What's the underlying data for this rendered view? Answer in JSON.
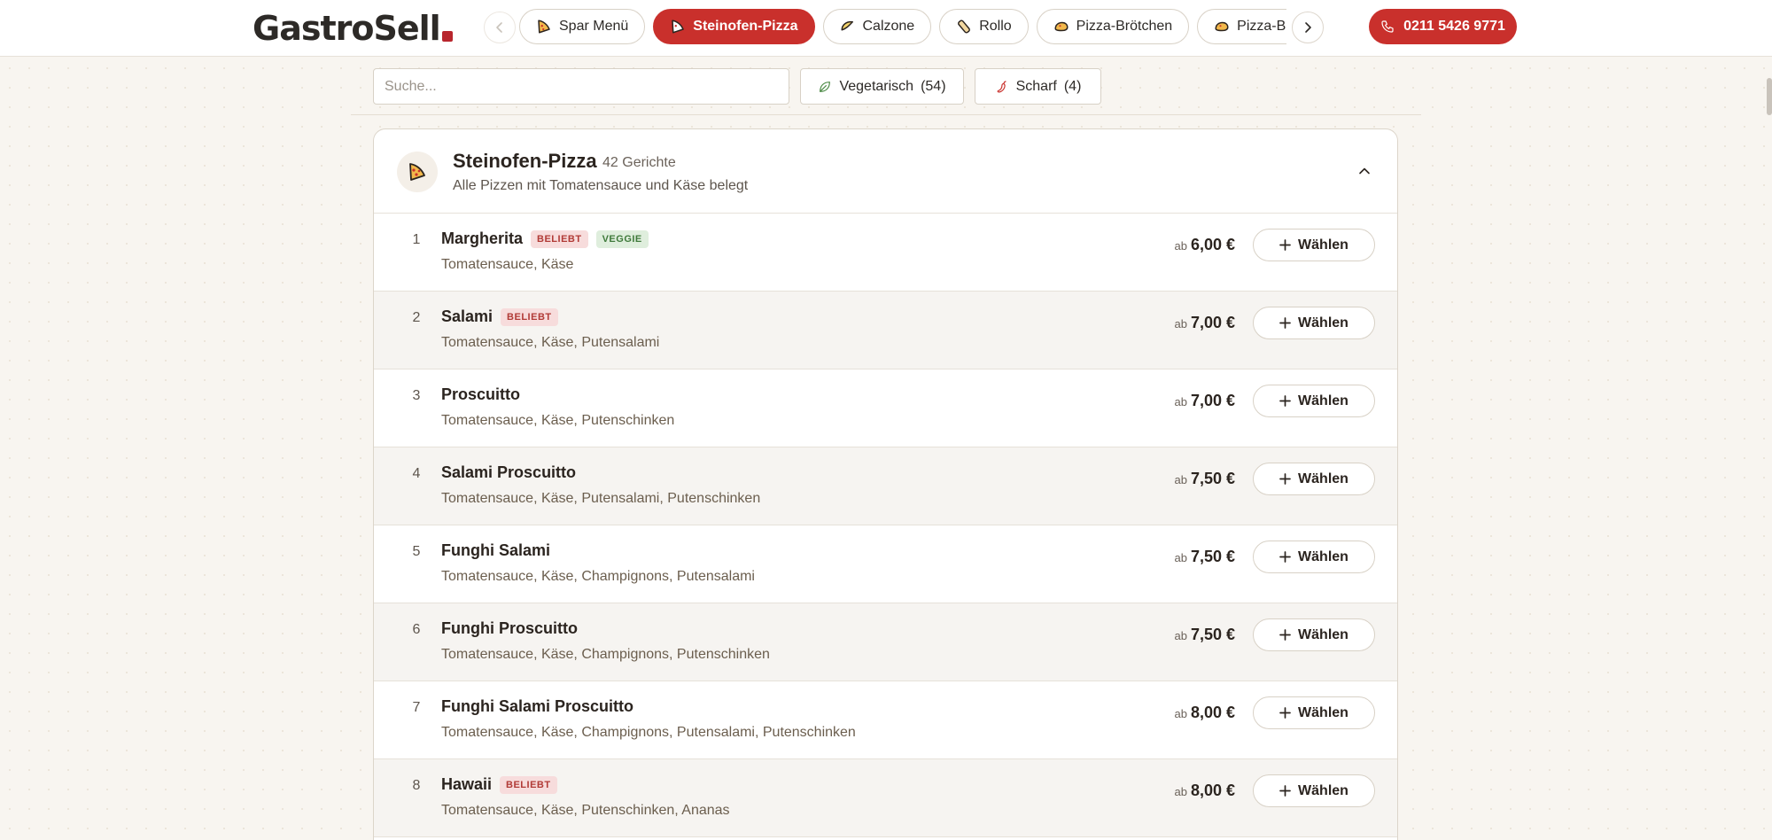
{
  "header": {
    "logo": "GastroSell",
    "tabs": [
      {
        "label": "Spar Menü",
        "icon": "pizza-slice-icon",
        "active": false
      },
      {
        "label": "Steinofen-Pizza",
        "icon": "pizza-slice-icon",
        "active": true
      },
      {
        "label": "Calzone",
        "icon": "calzone-icon",
        "active": false
      },
      {
        "label": "Rollo",
        "icon": "wrap-icon",
        "active": false
      },
      {
        "label": "Pizza-Brötchen",
        "icon": "bread-roll-icon",
        "active": false
      },
      {
        "label": "Pizza-Brot",
        "icon": "bread-roll-icon",
        "active": false
      }
    ],
    "phone": "0211 5426 9771"
  },
  "filters": {
    "search_placeholder": "Suche...",
    "vegetarian": "Vegetarisch",
    "vegetarian_count": "(54)",
    "spicy": "Scharf",
    "spicy_count": "(4)"
  },
  "category": {
    "title": "Steinofen-Pizza",
    "count": "42 Gerichte",
    "description": "Alle Pizzen mit Tomatensauce und Käse belegt"
  },
  "labels": {
    "price_prefix": "ab",
    "choose": "Wählen",
    "popular": "BELIEBT",
    "veggie": "VEGGIE"
  },
  "items": [
    {
      "num": "1",
      "name": "Margherita",
      "popular": true,
      "veggie": true,
      "desc": "Tomatensauce, Käse",
      "price": "6,00 €"
    },
    {
      "num": "2",
      "name": "Salami",
      "popular": true,
      "veggie": false,
      "desc": "Tomatensauce, Käse, Putensalami",
      "price": "7,00 €"
    },
    {
      "num": "3",
      "name": "Proscuitto",
      "popular": false,
      "veggie": false,
      "desc": "Tomatensauce, Käse, Putenschinken",
      "price": "7,00 €"
    },
    {
      "num": "4",
      "name": "Salami Proscuitto",
      "popular": false,
      "veggie": false,
      "desc": "Tomatensauce, Käse, Putensalami, Putenschinken",
      "price": "7,50 €"
    },
    {
      "num": "5",
      "name": "Funghi Salami",
      "popular": false,
      "veggie": false,
      "desc": "Tomatensauce, Käse, Champignons, Putensalami",
      "price": "7,50 €"
    },
    {
      "num": "6",
      "name": "Funghi Proscuitto",
      "popular": false,
      "veggie": false,
      "desc": "Tomatensauce, Käse, Champignons, Putenschinken",
      "price": "7,50 €"
    },
    {
      "num": "7",
      "name": "Funghi Salami Proscuitto",
      "popular": false,
      "veggie": false,
      "desc": "Tomatensauce, Käse, Champignons, Putensalami, Putenschinken",
      "price": "8,00 €"
    },
    {
      "num": "8",
      "name": "Hawaii",
      "popular": true,
      "veggie": false,
      "desc": "Tomatensauce, Käse, Putenschinken, Ananas",
      "price": "8,00 €"
    }
  ],
  "colors": {
    "accent": "#c9302c",
    "background": "#f8f5f0",
    "popular_bg": "#f7dcdc",
    "veggie_bg": "#dfeedd"
  }
}
